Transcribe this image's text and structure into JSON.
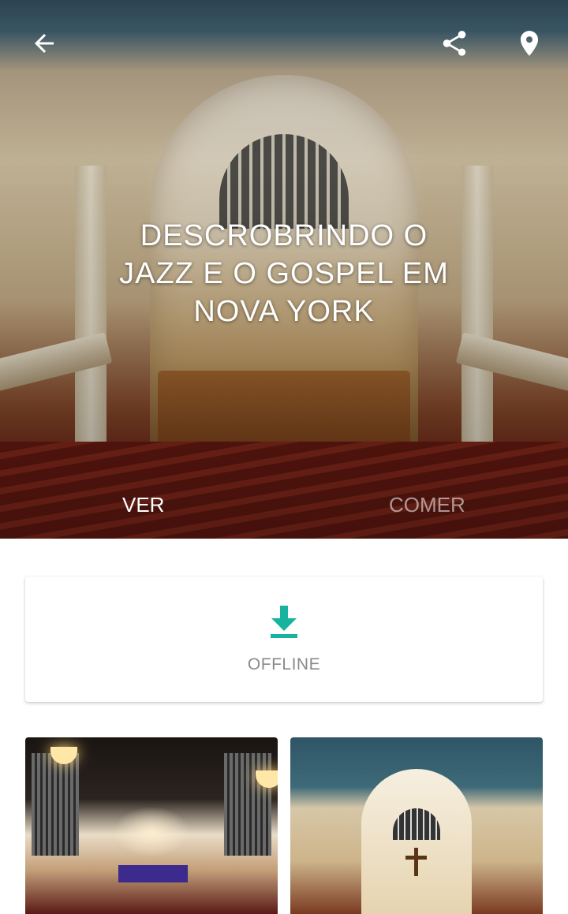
{
  "header": {
    "title": "DESCROBRINDO O\nJAZZ E O GOSPEL EM\nNOVA YORK",
    "icons": {
      "back": "arrow-left-icon",
      "share": "share-icon",
      "location": "map-pin-icon"
    }
  },
  "tabs": [
    {
      "label": "VER",
      "active": true
    },
    {
      "label": "COMER",
      "active": false
    }
  ],
  "offline": {
    "label": "OFFLINE",
    "icon": "download-icon",
    "icon_color": "#16b3a0"
  },
  "gallery": [
    {
      "name": "church-interior-service-photo"
    },
    {
      "name": "church-interior-arch-photo"
    }
  ]
}
